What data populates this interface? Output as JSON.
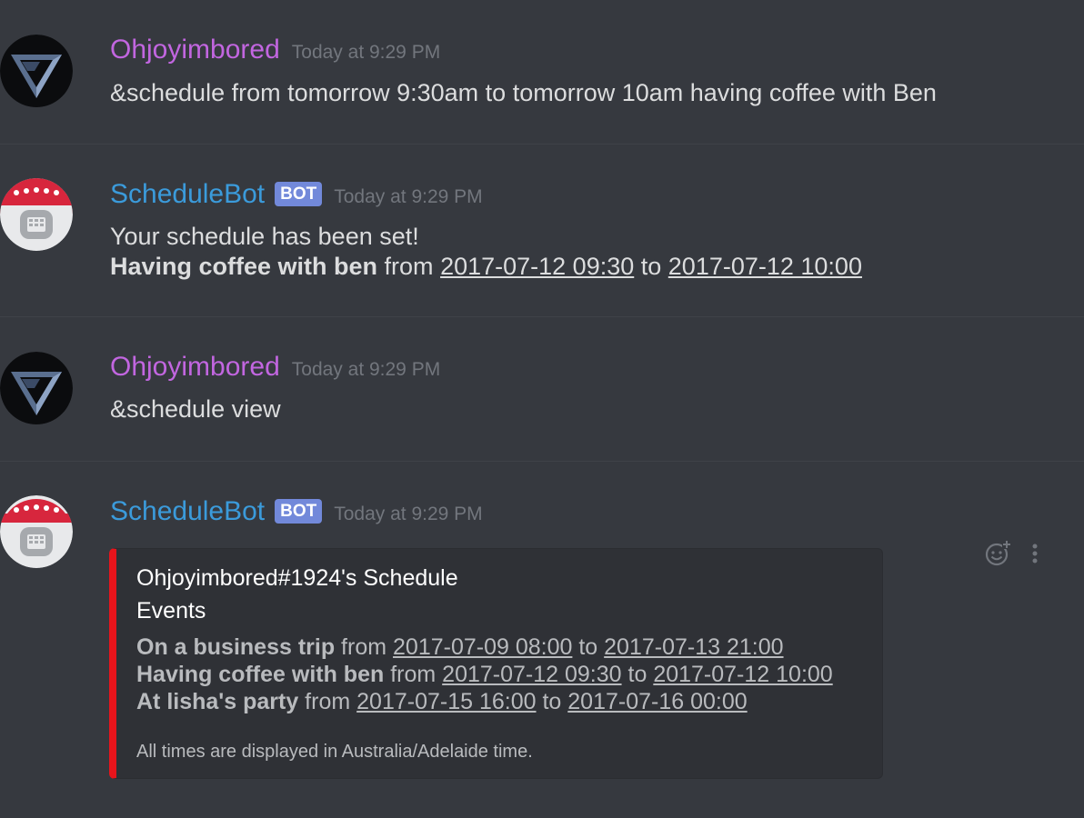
{
  "messages": [
    {
      "author": "Ohjoyimbored",
      "timestamp": "Today at 9:29 PM",
      "text": "&schedule from tomorrow 9:30am to tomorrow 10am having coffee with Ben"
    },
    {
      "author": "ScheduleBot",
      "bot_tag": "BOT",
      "timestamp": "Today at 9:29 PM",
      "line1": "Your schedule has been set!",
      "event_title": "Having coffee with ben",
      "from_word": " from ",
      "start": "2017-07-12 09:30",
      "to_word": " to ",
      "end": "2017-07-12 10:00"
    },
    {
      "author": "Ohjoyimbored",
      "timestamp": "Today at 9:29 PM",
      "text": "&schedule view"
    },
    {
      "author": "ScheduleBot",
      "bot_tag": "BOT",
      "timestamp": "Today at 9:29 PM",
      "embed": {
        "title": "Ohjoyimbored#1924's Schedule",
        "field_name": "Events",
        "events": [
          {
            "name": "On a business trip",
            "from": " from ",
            "start": "2017-07-09 08:00",
            "to": " to ",
            "end": "2017-07-13 21:00"
          },
          {
            "name": "Having coffee with ben",
            "from": " from ",
            "start": "2017-07-12 09:30",
            "to": " to ",
            "end": "2017-07-12 10:00"
          },
          {
            "name": "At lisha's party",
            "from": " from ",
            "start": "2017-07-15 16:00",
            "to": " to ",
            "end": "2017-07-16 00:00"
          }
        ],
        "footer": "All times are displayed in Australia/Adelaide time.",
        "accent_color": "#e8141b"
      },
      "actions": [
        "add-reaction-icon",
        "more-options-icon"
      ]
    }
  ],
  "colors": {
    "background": "#36393f",
    "user_name": "#c266e0",
    "bot_name": "#3b9bdb",
    "bot_tag": "#7289da"
  }
}
